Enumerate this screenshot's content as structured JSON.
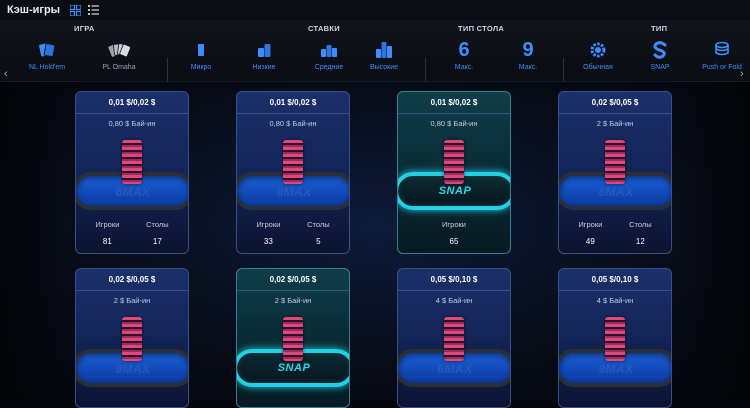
{
  "app": {
    "title": "Кэш-игры"
  },
  "filters": {
    "groups": {
      "game": "ИГРА",
      "stakes": "СТАВКИ",
      "table_type": "ТИП СТОЛА",
      "type": "ТИП"
    },
    "items": {
      "nlh": "NL Hold'em",
      "plo": "PL Omaha",
      "micro": "Микро",
      "low": "Низкие",
      "mid": "Средние",
      "high": "Высокие",
      "max6": "Макс.",
      "max9": "Макс.",
      "regular": "Обычная",
      "snap": "SNAP",
      "pushfold": "Push or Fold"
    },
    "numbers": {
      "six": "6",
      "nine": "9"
    }
  },
  "cards": [
    {
      "stakes": "0,01 $/0,02 $",
      "buyin": "0,80 $ Бай-ин",
      "logo": "6MAX",
      "players_label": "Игроки",
      "tables_label": "Столы",
      "players": "81",
      "tables": "17"
    },
    {
      "stakes": "0,01 $/0,02 $",
      "buyin": "0,80 $ Бай-ин",
      "logo": "9MAX",
      "players_label": "Игроки",
      "tables_label": "Столы",
      "players": "33",
      "tables": "5"
    },
    {
      "stakes": "0,01 $/0,02 $",
      "buyin": "0,80 $ Бай-ин",
      "logo": "SNAP",
      "players_label": "Игроки",
      "players": "65"
    },
    {
      "stakes": "0,02 $/0,05 $",
      "buyin": "2 $ Бай-ин",
      "logo": "6MAX",
      "players_label": "Игроки",
      "tables_label": "Столы",
      "players": "49",
      "tables": "12"
    },
    {
      "stakes": "0,02 $/0,05 $",
      "buyin": "2 $ Бай-ин",
      "logo": "9MAX"
    },
    {
      "stakes": "0,02 $/0,05 $",
      "buyin": "2 $ Бай-ин",
      "logo": "SNAP"
    },
    {
      "stakes": "0,05 $/0,10 $",
      "buyin": "4 $ Бай-ин",
      "logo": "6MAX"
    },
    {
      "stakes": "0,05 $/0,10 $",
      "buyin": "4 $ Бай-ин",
      "logo": "9MAX"
    }
  ],
  "colors": {
    "accent": "#3f8cff",
    "snap": "#22d1e6",
    "table_blue": "#1a5fd8"
  }
}
